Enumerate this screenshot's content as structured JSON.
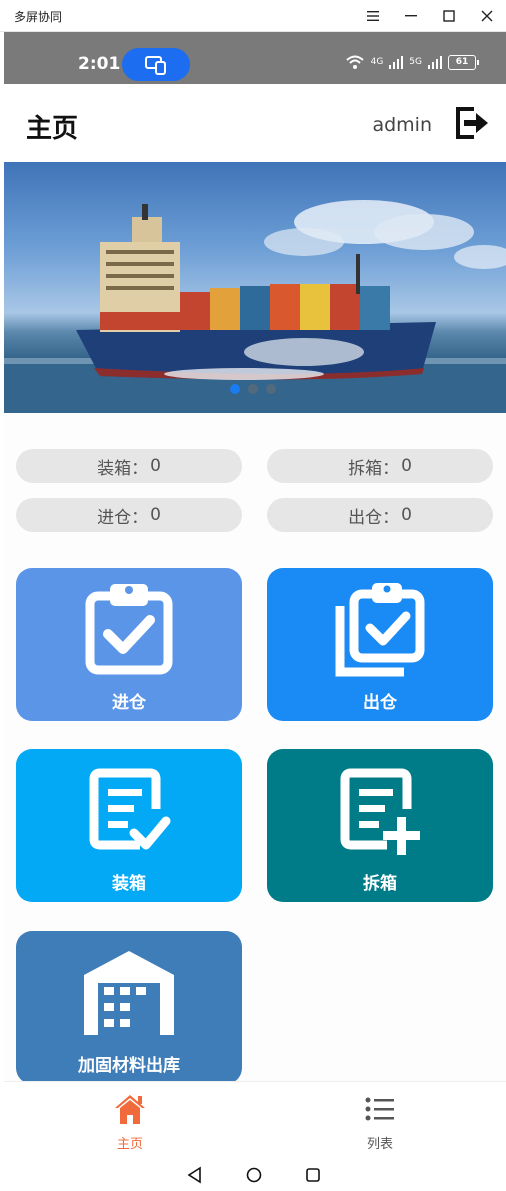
{
  "window": {
    "title": "多屏协同"
  },
  "status_bar": {
    "time": "2:01",
    "net1": "4G",
    "net2": "5G",
    "battery": "61"
  },
  "header": {
    "title": "主页",
    "username": "admin"
  },
  "banner": {
    "slide_count": 3,
    "active_index": 0
  },
  "stats": [
    {
      "label": "装箱",
      "sep": "：",
      "value": "0"
    },
    {
      "label": "拆箱",
      "sep": "：",
      "value": "0"
    },
    {
      "label": "进仓",
      "sep": "：",
      "value": "0"
    },
    {
      "label": "出仓",
      "sep": "：",
      "value": "0"
    }
  ],
  "tiles": [
    {
      "label": "进仓",
      "icon": "clipboard-check-icon",
      "color": "#5b95e8"
    },
    {
      "label": "出仓",
      "icon": "clipboard-copy-check-icon",
      "color": "#1a8af5"
    },
    {
      "label": "装箱",
      "icon": "document-check-icon",
      "color": "#03a9f4"
    },
    {
      "label": "拆箱",
      "icon": "document-add-icon",
      "color": "#007c89"
    },
    {
      "label": "加固材料出库",
      "icon": "warehouse-icon",
      "color": "#3f7db8"
    }
  ],
  "bottom_nav": [
    {
      "label": "主页",
      "icon": "home-icon",
      "active": true,
      "color": "#f06a3b"
    },
    {
      "label": "列表",
      "icon": "list-icon",
      "active": false,
      "color": "#555555"
    }
  ]
}
